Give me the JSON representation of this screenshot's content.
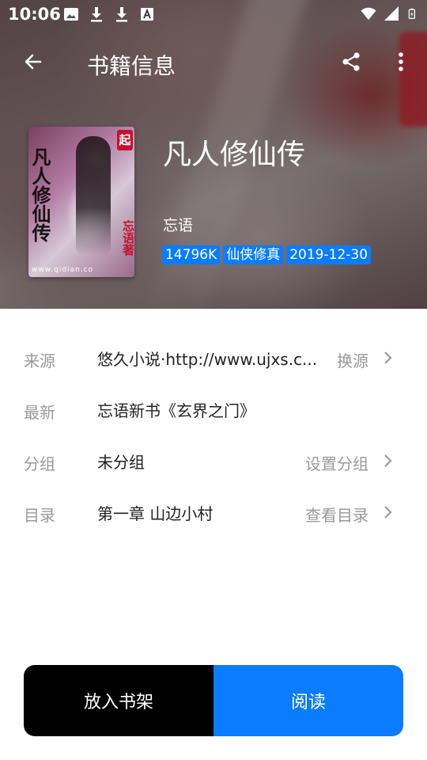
{
  "status_bar": {
    "time": "10:06",
    "left_icons": [
      "image-icon",
      "download-icon",
      "download-icon",
      "font-icon"
    ],
    "right_icons": [
      "wifi-icon",
      "signal-icon",
      "battery-charging-icon"
    ]
  },
  "toolbar": {
    "title": "书籍信息",
    "back_icon": "arrow-left-icon",
    "share_icon": "share-icon",
    "more_icon": "more-vertical-icon"
  },
  "cover": {
    "title_text": "凡人修仙传",
    "badge": "起",
    "author_text": "忘语著",
    "url_text": "www.qidian.co"
  },
  "book": {
    "title": "凡人修仙传",
    "author": "忘语",
    "tags": [
      "14796K",
      "仙侠修真",
      "2019-12-30"
    ],
    "tag_color": "#0a7cff"
  },
  "details": [
    {
      "label": "来源",
      "value": "悠久小说·http://www.ujxs.c...",
      "action": "换源",
      "has_chevron": true
    },
    {
      "label": "最新",
      "value": "忘语新书《玄界之门》",
      "action": "",
      "has_chevron": false
    },
    {
      "label": "分组",
      "value": "未分组",
      "action": "设置分组",
      "has_chevron": true
    },
    {
      "label": "目录",
      "value": "第一章 山边小村",
      "action": "查看目录",
      "has_chevron": true
    }
  ],
  "buttons": {
    "shelf_label": "放入书架",
    "read_label": "阅读",
    "shelf_color": "#000000",
    "read_color": "#0a7cff"
  }
}
